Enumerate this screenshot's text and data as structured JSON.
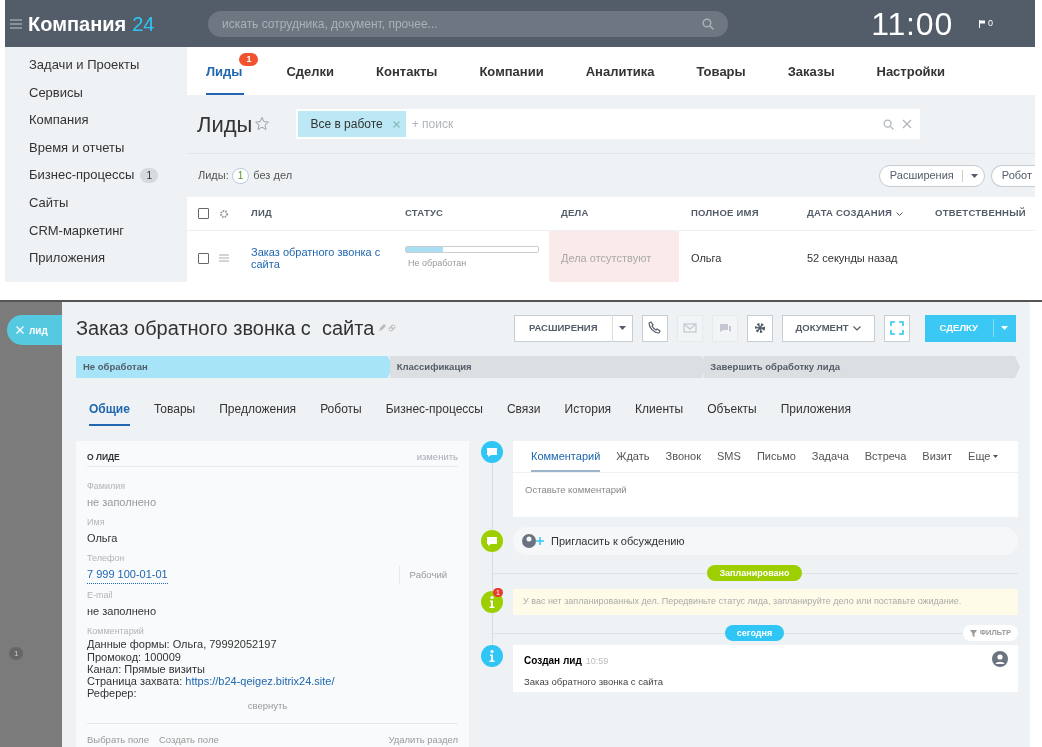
{
  "portal": {
    "logo": "Компания",
    "logo_number": "24",
    "search_placeholder": "искать сотрудника, документ, прочее...",
    "clock": "11:00",
    "flag_count": "0",
    "sidebar": [
      {
        "label": "Задачи и Проекты"
      },
      {
        "label": "Сервисы"
      },
      {
        "label": "Компания"
      },
      {
        "label": "Время и отчеты"
      },
      {
        "label": "Бизнес-процессы",
        "badge": "1"
      },
      {
        "label": "Сайты"
      },
      {
        "label": "CRM-маркетинг"
      },
      {
        "label": "Приложения"
      }
    ],
    "tabs": [
      {
        "label": "Лиды",
        "selected": true,
        "badge": "1"
      },
      {
        "label": "Сделки",
        "selected": false
      },
      {
        "label": "Контакты",
        "selected": false
      },
      {
        "label": "Компании",
        "selected": false
      },
      {
        "label": "Аналитика",
        "selected": false
      },
      {
        "label": "Товары",
        "selected": false
      },
      {
        "label": "Заказы",
        "selected": false
      },
      {
        "label": "Настройки",
        "selected": false
      }
    ],
    "page_title": "Лиды",
    "filter_chip": "Все в работе",
    "filter_placeholder": "+ поиск",
    "counter": {
      "label": "Лиды:",
      "count": "1",
      "suffix": "без дел"
    },
    "toolbar_buttons": [
      {
        "label": "Расширения",
        "dropdown": true
      },
      {
        "label": "Робот",
        "dropdown": false
      }
    ],
    "table": {
      "all_checked": false,
      "columns": [
        {
          "label": "ЛИД",
          "sorted": false
        },
        {
          "label": "СТАТУС",
          "sorted": false
        },
        {
          "label": "ДЕЛА",
          "sorted": false
        },
        {
          "label": "ПОЛНОЕ ИМЯ",
          "sorted": false
        },
        {
          "label": "ДАТА СОЗДАНИЯ",
          "sorted": true
        },
        {
          "label": "ОТВЕТСТВЕННЫЙ",
          "sorted": false
        }
      ],
      "rows": [
        {
          "checked": false,
          "lead": "Заказ обратного звонка с сайта",
          "level": 0.28,
          "status": "Не обработан",
          "activities": "Дела отсутствуют",
          "activities_overdue": true,
          "full_name": "Ольга",
          "created": "52 секунды назад"
        }
      ]
    }
  },
  "lead_card": {
    "close_tab": "лид",
    "side_badge": "1",
    "title": "Заказ обратного звонка с  сайта",
    "toolbar": [
      {
        "kind": "menu",
        "label": "РАСШИРЕНИЯ"
      },
      {
        "kind": "phone",
        "disabled": false
      },
      {
        "kind": "mail",
        "disabled": true
      },
      {
        "kind": "chat",
        "disabled": true
      },
      {
        "kind": "gear",
        "disabled": false
      },
      {
        "kind": "dropdown",
        "label": "ДОКУМЕНТ"
      },
      {
        "kind": "expand",
        "disabled": false
      },
      {
        "kind": "primary",
        "label": "СДЕЛКУ"
      }
    ],
    "stages": [
      {
        "label": "Не обработан",
        "selected": true
      },
      {
        "label": "Классификация",
        "selected": false
      },
      {
        "label": "Завершить обработку лида",
        "selected": false
      }
    ],
    "tabs": [
      {
        "label": "Общие",
        "selected": true
      },
      {
        "label": "Товары",
        "selected": false
      },
      {
        "label": "Предложения",
        "selected": false
      },
      {
        "label": "Роботы",
        "selected": false
      },
      {
        "label": "Бизнес-процессы",
        "selected": false
      },
      {
        "label": "Связи",
        "selected": false
      },
      {
        "label": "История",
        "selected": false
      },
      {
        "label": "Клиенты",
        "selected": false
      },
      {
        "label": "Объекты",
        "selected": false
      },
      {
        "label": "Приложения",
        "selected": false
      }
    ],
    "section": {
      "title": "О ЛИДЕ",
      "edit": "изменить",
      "fields": [
        {
          "kind": "text",
          "label": "Фамилия",
          "value": "не заполнено",
          "empty": true
        },
        {
          "kind": "text",
          "label": "Имя",
          "value": "Ольга",
          "empty": false
        },
        {
          "kind": "phone",
          "label": "Телефон",
          "value": "7 999 100-01-01",
          "type": "Рабочий"
        },
        {
          "kind": "text",
          "label": "E-mail",
          "value": "не заполнено",
          "empty": false
        }
      ],
      "comment": {
        "label": "Комментарий",
        "lines": [
          {
            "text": "Данные формы: Ольга, 79992052197"
          },
          {
            "text": "Промокод: 100009"
          },
          {
            "text": "Канал: Прямые визиты"
          },
          {
            "text": "Страница захвата: ",
            "link": "https://b24-qeigez.bitrix24.site/"
          },
          {
            "text": "Реферер:"
          }
        ],
        "collapse": "свернуть"
      },
      "footer": {
        "links": [
          "Выбрать поле",
          "Создать поле"
        ],
        "delete": "Удалить раздел"
      }
    },
    "timeline": {
      "composer_tabs": [
        {
          "label": "Комментарий",
          "selected": true
        },
        {
          "label": "Ждать",
          "selected": false
        },
        {
          "label": "Звонок",
          "selected": false
        },
        {
          "label": "SMS",
          "selected": false
        },
        {
          "label": "Письмо",
          "selected": false
        },
        {
          "label": "Задача",
          "selected": false
        },
        {
          "label": "Встреча",
          "selected": false
        },
        {
          "label": "Визит",
          "selected": false
        },
        {
          "label": "Еще",
          "selected": false,
          "dropdown": true
        }
      ],
      "comment_placeholder": "Оставьте комментарий",
      "invite": "Пригласить к обсуждению",
      "planned_label": "Запланировано",
      "notice_badge": "1",
      "notice": "У вас нет запланированных дел. Передвиньте статус лида, запланируйте дело или поставьте ожидание.",
      "today_label": "сегодня",
      "filter": "ФИЛЬТР",
      "event": {
        "title": "Создан лид",
        "time": "10:59",
        "text": "Заказ обратного звонка с сайта"
      }
    }
  }
}
